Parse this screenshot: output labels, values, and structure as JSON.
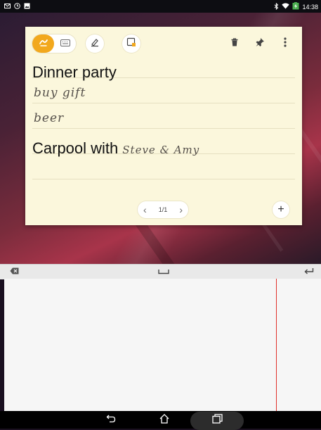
{
  "status_bar": {
    "time": "14:38",
    "icons_left": [
      "mail-icon",
      "clock-icon",
      "image-icon"
    ],
    "icons_right": [
      "bluetooth-icon",
      "wifi-icon",
      "battery-charging-icon"
    ]
  },
  "note": {
    "toolbar": {
      "handwriting_mode_icon": "pen-icon",
      "keyboard_mode_icon": "keyboard-icon",
      "draw_icon": "draw-icon",
      "insert_icon": "insert-image-icon",
      "delete_icon": "trash-icon",
      "pin_icon": "pin-icon",
      "more_icon": "more-vert-icon"
    },
    "lines": {
      "line1_typed": "Dinner party",
      "line2_handwritten": "buy gift",
      "line3_handwritten": "beer",
      "line4_typed": "Carpool with",
      "line4_handwritten": "Steve & Amy"
    },
    "pager": {
      "label": "1/1"
    },
    "add_page_label": "+"
  },
  "handwriting_panel": {
    "backspace_icon": "backspace-icon",
    "space_icon": "space-icon",
    "enter_icon": "enter-icon"
  },
  "nav_bar": {
    "back_icon": "back-icon",
    "home_icon": "home-icon",
    "recents_icon": "recents-icon"
  },
  "colors": {
    "accent": "#f2a81d",
    "note_background": "#fbf7dc",
    "margin_line": "#e0302a"
  }
}
